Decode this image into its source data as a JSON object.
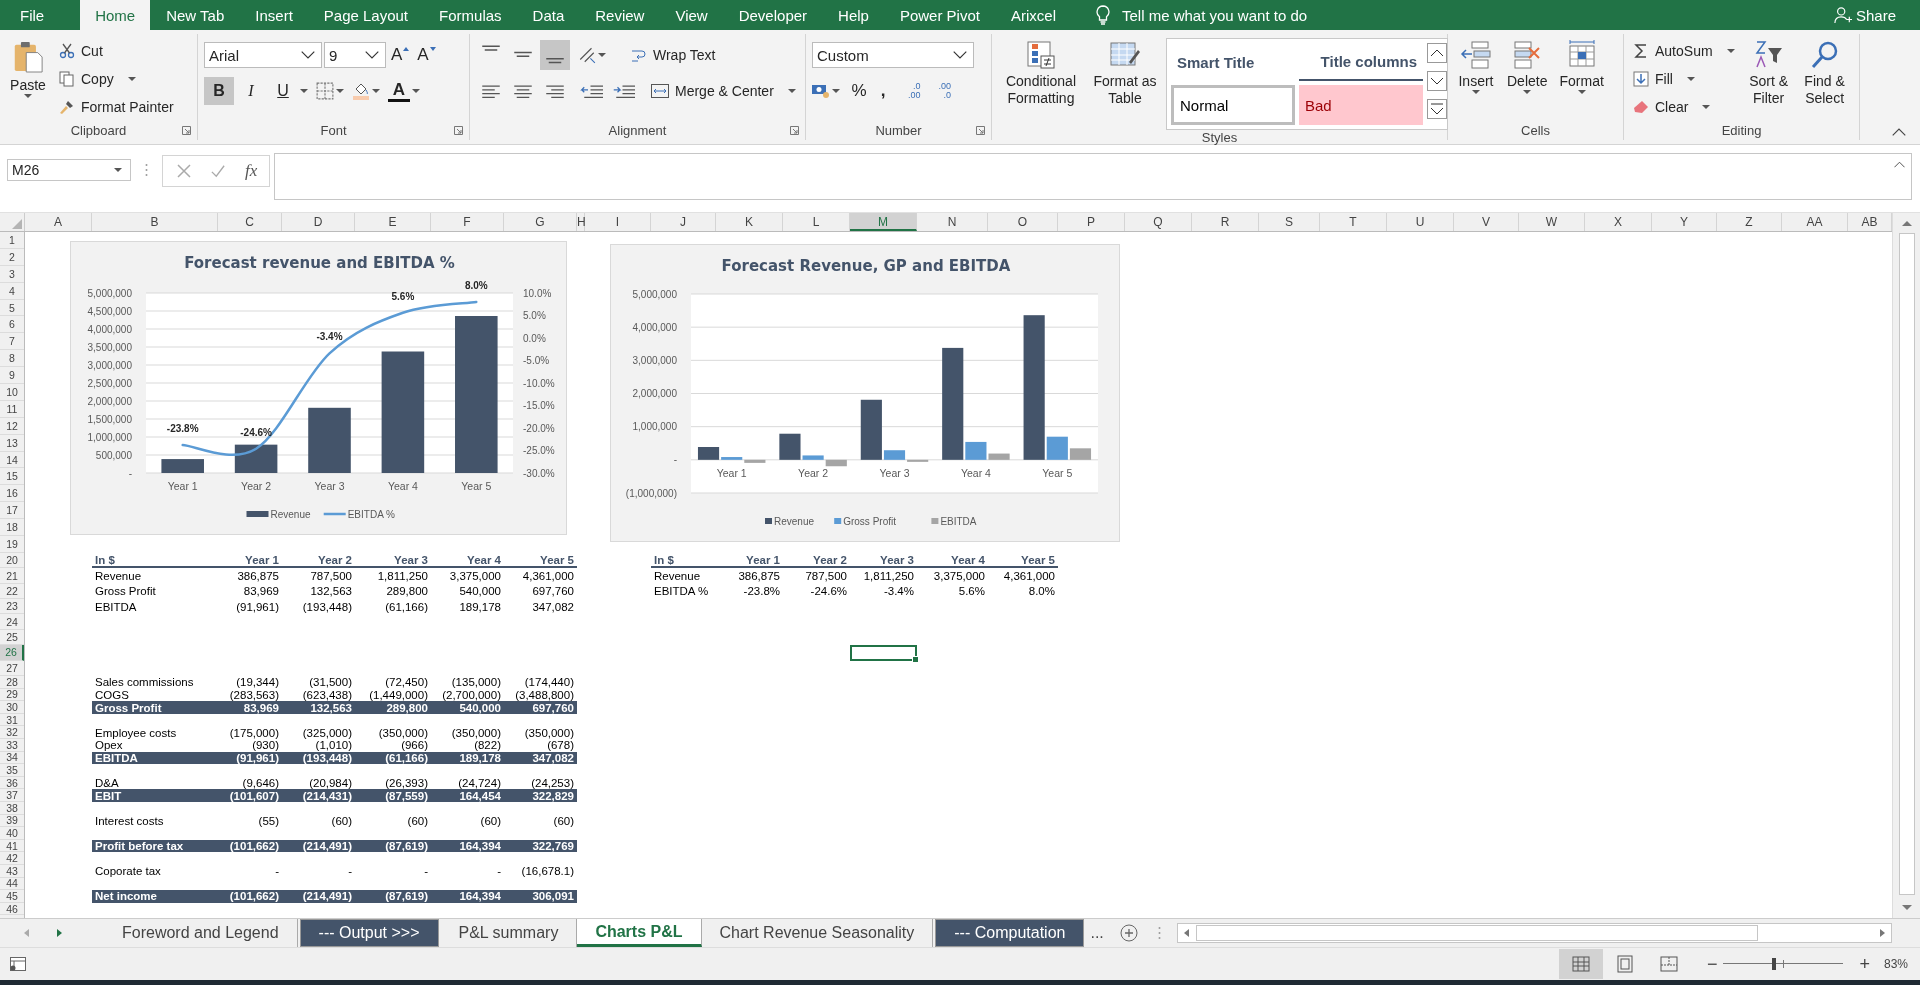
{
  "menu": {
    "tabs": [
      {
        "label": "File",
        "selected": false
      },
      {
        "label": "Home",
        "selected": true
      },
      {
        "label": "New Tab",
        "selected": false
      },
      {
        "label": "Insert",
        "selected": false
      },
      {
        "label": "Page Layout",
        "selected": false
      },
      {
        "label": "Formulas",
        "selected": false
      },
      {
        "label": "Data",
        "selected": false
      },
      {
        "label": "Review",
        "selected": false
      },
      {
        "label": "View",
        "selected": false
      },
      {
        "label": "Developer",
        "selected": false
      },
      {
        "label": "Help",
        "selected": false
      },
      {
        "label": "Power Pivot",
        "selected": false
      },
      {
        "label": "Arixcel",
        "selected": false
      }
    ],
    "tell_me": "Tell me what you want to do",
    "share": "Share"
  },
  "ribbon": {
    "clipboard": {
      "paste": "Paste",
      "cut": "Cut",
      "copy": "Copy",
      "format_painter": "Format Painter",
      "label": "Clipboard"
    },
    "font": {
      "name": "Arial",
      "size": "9",
      "grow": "A",
      "shrink": "A",
      "styles": [
        {
          "label": "B",
          "on": true
        },
        {
          "label": "I",
          "on": false
        },
        {
          "label": "U",
          "on": false
        }
      ],
      "font_color": "A",
      "label": "Font"
    },
    "alignment": {
      "vertical": [
        {
          "selected": false
        },
        {
          "selected": false
        },
        {
          "selected": true
        }
      ],
      "wrap_text": "Wrap Text",
      "merge_center": "Merge & Center",
      "label": "Alignment"
    },
    "number": {
      "format": "Custom",
      "percent": "%",
      "comma": ",",
      "increase_decimal": {
        "top": ".0",
        "bottom": ".00"
      },
      "decrease_decimal": {
        "top": ".00",
        "bottom": ".0"
      },
      "label": "Number"
    },
    "styles": {
      "conditional_formatting": "Conditional Formatting",
      "format_as_table": "Format as Table",
      "cells": [
        {
          "label": "Smart Title",
          "kind": "smart-title"
        },
        {
          "label": "Title columns",
          "kind": "title-columns"
        },
        {
          "label": "Normal",
          "kind": "normal"
        },
        {
          "label": "Bad",
          "kind": "bad"
        }
      ],
      "label": "Styles"
    },
    "cells": {
      "insert": "Insert",
      "delete": "Delete",
      "format": "Format",
      "label": "Cells"
    },
    "editing": {
      "autosum": "AutoSum",
      "fill": "Fill",
      "clear": "Clear",
      "sort_filter": "Sort & Filter",
      "find_select": "Find & Select",
      "label": "Editing"
    }
  },
  "formula_bar": {
    "name_box": "M26",
    "fx": "fx"
  },
  "sheet": {
    "columns": [
      {
        "label": "A",
        "selected": false
      },
      {
        "label": "B",
        "selected": false
      },
      {
        "label": "C",
        "selected": false
      },
      {
        "label": "D",
        "selected": false
      },
      {
        "label": "E",
        "selected": false
      },
      {
        "label": "F",
        "selected": false
      },
      {
        "label": "G",
        "selected": false
      },
      {
        "label": "H",
        "selected": false
      },
      {
        "label": "I",
        "selected": false
      },
      {
        "label": "J",
        "selected": false
      },
      {
        "label": "K",
        "selected": false
      },
      {
        "label": "L",
        "selected": false
      },
      {
        "label": "M",
        "selected": true
      },
      {
        "label": "N",
        "selected": false
      },
      {
        "label": "O",
        "selected": false
      },
      {
        "label": "P",
        "selected": false
      },
      {
        "label": "Q",
        "selected": false
      },
      {
        "label": "R",
        "selected": false
      },
      {
        "label": "S",
        "selected": false
      },
      {
        "label": "T",
        "selected": false
      },
      {
        "label": "U",
        "selected": false
      },
      {
        "label": "V",
        "selected": false
      },
      {
        "label": "W",
        "selected": false
      },
      {
        "label": "X",
        "selected": false
      },
      {
        "label": "Y",
        "selected": false
      },
      {
        "label": "Z",
        "selected": false
      },
      {
        "label": "AA",
        "selected": false
      },
      {
        "label": "AB",
        "selected": false
      }
    ],
    "rows": [
      {
        "label": "1",
        "selected": false
      },
      {
        "label": "2",
        "selected": false
      },
      {
        "label": "3",
        "selected": false
      },
      {
        "label": "4",
        "selected": false
      },
      {
        "label": "5",
        "selected": false
      },
      {
        "label": "6",
        "selected": false
      },
      {
        "label": "7",
        "selected": false
      },
      {
        "label": "8",
        "selected": false
      },
      {
        "label": "9",
        "selected": false
      },
      {
        "label": "10",
        "selected": false
      },
      {
        "label": "11",
        "selected": false
      },
      {
        "label": "12",
        "selected": false
      },
      {
        "label": "13",
        "selected": false
      },
      {
        "label": "14",
        "selected": false
      },
      {
        "label": "15",
        "selected": false
      },
      {
        "label": "16",
        "selected": false
      },
      {
        "label": "17",
        "selected": false
      },
      {
        "label": "18",
        "selected": false
      },
      {
        "label": "19",
        "selected": false
      },
      {
        "label": "20",
        "selected": false
      },
      {
        "label": "21",
        "selected": false
      },
      {
        "label": "22",
        "selected": false
      },
      {
        "label": "23",
        "selected": false
      },
      {
        "label": "24",
        "selected": false
      },
      {
        "label": "25",
        "selected": false
      },
      {
        "label": "26",
        "selected": true
      },
      {
        "label": "27",
        "selected": false
      },
      {
        "label": "28",
        "selected": false
      },
      {
        "label": "29",
        "selected": false
      },
      {
        "label": "30",
        "selected": false
      },
      {
        "label": "31",
        "selected": false
      },
      {
        "label": "32",
        "selected": false
      },
      {
        "label": "33",
        "selected": false
      },
      {
        "label": "34",
        "selected": false
      },
      {
        "label": "35",
        "selected": false
      },
      {
        "label": "36",
        "selected": false
      },
      {
        "label": "37",
        "selected": false
      },
      {
        "label": "38",
        "selected": false
      },
      {
        "label": "39",
        "selected": false
      },
      {
        "label": "40",
        "selected": false
      },
      {
        "label": "41",
        "selected": false
      },
      {
        "label": "42",
        "selected": false
      },
      {
        "label": "43",
        "selected": false
      },
      {
        "label": "44",
        "selected": false
      },
      {
        "label": "45",
        "selected": false
      },
      {
        "label": "46",
        "selected": false
      }
    ],
    "charts": [
      {
        "chart_data": {
          "type": "bar",
          "title": "Forecast revenue and EBITDA %",
          "categories": [
            "Year 1",
            "Year 2",
            "Year 3",
            "Year 4",
            "Year 5"
          ],
          "series": [
            {
              "name": "Revenue",
              "color": "#44546a",
              "type": "bar",
              "values": [
                386875,
                787500,
                1811250,
                3375000,
                4361000
              ]
            },
            {
              "name": "EBITDA %",
              "color": "#5b9bd5",
              "type": "line",
              "axis": "y2",
              "values": [
                -23.8,
                -24.6,
                -3.4,
                5.6,
                8.0
              ]
            }
          ],
          "grid": true,
          "legend": "bottom",
          "ylim": [
            0,
            5000000
          ],
          "yticks": [
            {
              "value": 0,
              "label": "-"
            },
            {
              "value": 500000,
              "label": "500,000"
            },
            {
              "value": 1000000,
              "label": "1,000,000"
            },
            {
              "value": 1500000,
              "label": "1,500,000"
            },
            {
              "value": 2000000,
              "label": "2,000,000"
            },
            {
              "value": 2500000,
              "label": "2,500,000"
            },
            {
              "value": 3000000,
              "label": "3,000,000"
            },
            {
              "value": 3500000,
              "label": "3,500,000"
            },
            {
              "value": 4000000,
              "label": "4,000,000"
            },
            {
              "value": 4500000,
              "label": "4,500,000"
            },
            {
              "value": 5000000,
              "label": "5,000,000"
            }
          ],
          "y2lim": [
            -30,
            10
          ],
          "y2ticks": [
            {
              "value": -30,
              "label": "-30.0%"
            },
            {
              "value": -25,
              "label": "-25.0%"
            },
            {
              "value": -20,
              "label": "-20.0%"
            },
            {
              "value": -15,
              "label": "-15.0%"
            },
            {
              "value": -10,
              "label": "-10.0%"
            },
            {
              "value": -5,
              "label": "-5.0%"
            },
            {
              "value": 0,
              "label": "0.0%"
            },
            {
              "value": 5,
              "label": "5.0%"
            },
            {
              "value": 10,
              "label": "10.0%"
            }
          ],
          "value_labels": [
            "-23.8%",
            "-24.6%",
            "-3.4%",
            "5.6%",
            "8.0%"
          ]
        }
      },
      {
        "chart_data": {
          "type": "bar",
          "title": "Forecast Revenue, GP and EBITDA",
          "categories": [
            "Year 1",
            "Year 2",
            "Year 3",
            "Year 4",
            "Year 5"
          ],
          "series": [
            {
              "name": "Revenue",
              "color": "#44546a",
              "type": "bar",
              "values": [
                386875,
                787500,
                1811250,
                3375000,
                4361000
              ]
            },
            {
              "name": "Gross Profit",
              "color": "#5b9bd5",
              "type": "bar",
              "values": [
                83969,
                132563,
                289800,
                540000,
                697760
              ]
            },
            {
              "name": "EBITDA",
              "color": "#a5a5a5",
              "type": "bar",
              "values": [
                -91961,
                -193448,
                -61166,
                189178,
                347082
              ]
            }
          ],
          "grid": true,
          "legend": "bottom",
          "ylim": [
            -1000000,
            5000000
          ],
          "yticks": [
            {
              "value": -1000000,
              "label": "(1,000,000)"
            },
            {
              "value": 0,
              "label": "-"
            },
            {
              "value": 1000000,
              "label": "1,000,000"
            },
            {
              "value": 2000000,
              "label": "2,000,000"
            },
            {
              "value": 3000000,
              "label": "3,000,000"
            },
            {
              "value": 4000000,
              "label": "4,000,000"
            },
            {
              "value": 5000000,
              "label": "5,000,000"
            }
          ]
        }
      }
    ],
    "summary_table": {
      "columns": [
        "In $",
        "Year 1",
        "Year 2",
        "Year 3",
        "Year 4",
        "Year 5"
      ],
      "rows": [
        [
          "Revenue",
          "386,875",
          "787,500",
          "1,811,250",
          "3,375,000",
          "4,361,000"
        ],
        [
          "Gross Profit",
          "83,969",
          "132,563",
          "289,800",
          "540,000",
          "697,760"
        ],
        [
          "EBITDA",
          "(91,961)",
          "(193,448)",
          "(61,166)",
          "189,178",
          "347,082"
        ]
      ]
    },
    "ebitda_table": {
      "columns": [
        "In $",
        "Year 1",
        "Year 2",
        "Year 3",
        "Year 4",
        "Year 5"
      ],
      "rows": [
        [
          "Revenue",
          "386,875",
          "787,500",
          "1,811,250",
          "3,375,000",
          "4,361,000"
        ],
        [
          "EBITDA %",
          "-23.8%",
          "-24.6%",
          "-3.4%",
          "5.6%",
          "8.0%"
        ]
      ]
    },
    "pnl_table": {
      "sections": [
        [
          {
            "kind": "line",
            "cells": [
              "Sales commissions",
              "(19,344)",
              "(31,500)",
              "(72,450)",
              "(135,000)",
              "(174,440)"
            ]
          },
          {
            "kind": "line",
            "cells": [
              "COGS",
              "(283,563)",
              "(623,438)",
              "(1,449,000)",
              "(2,700,000)",
              "(3,488,800)"
            ]
          },
          {
            "kind": "total",
            "cells": [
              "Gross Profit",
              "83,969",
              "132,563",
              "289,800",
              "540,000",
              "697,760"
            ]
          }
        ],
        [
          {
            "kind": "line",
            "cells": [
              "Employee costs",
              "(175,000)",
              "(325,000)",
              "(350,000)",
              "(350,000)",
              "(350,000)"
            ]
          },
          {
            "kind": "line",
            "cells": [
              "Opex",
              "(930)",
              "(1,010)",
              "(966)",
              "(822)",
              "(678)"
            ]
          },
          {
            "kind": "total",
            "cells": [
              "EBITDA",
              "(91,961)",
              "(193,448)",
              "(61,166)",
              "189,178",
              "347,082"
            ]
          }
        ],
        [
          {
            "kind": "line",
            "cells": [
              "D&A",
              "(9,646)",
              "(20,984)",
              "(26,393)",
              "(24,724)",
              "(24,253)"
            ]
          },
          {
            "kind": "total",
            "cells": [
              "EBIT",
              "(101,607)",
              "(214,431)",
              "(87,559)",
              "164,454",
              "322,829"
            ]
          }
        ],
        [
          {
            "kind": "line",
            "cells": [
              "Interest costs",
              "(55)",
              "(60)",
              "(60)",
              "(60)",
              "(60)"
            ]
          }
        ],
        [
          {
            "kind": "total",
            "cells": [
              "Profit before tax",
              "(101,662)",
              "(214,491)",
              "(87,619)",
              "164,394",
              "322,769"
            ]
          }
        ],
        [
          {
            "kind": "line",
            "cells": [
              "Coporate tax",
              "-",
              "-",
              "-",
              "-",
              "(16,678.1)"
            ]
          }
        ],
        [
          {
            "kind": "total",
            "cells": [
              "Net income",
              "(101,662)",
              "(214,491)",
              "(87,619)",
              "164,394",
              "306,091"
            ]
          }
        ]
      ]
    }
  },
  "sheet_tabs": {
    "tabs": [
      {
        "label": "Foreword and Legend",
        "selected": false
      },
      {
        "label": "--- Output >>>",
        "selected": false,
        "color": "#44546a"
      },
      {
        "label": "P&L summary",
        "selected": false
      },
      {
        "label": "Charts P&L",
        "selected": true
      },
      {
        "label": "Chart Revenue Seasonality",
        "selected": false
      },
      {
        "label": "--- Computation",
        "selected": false,
        "color": "#44546a"
      }
    ],
    "more": "..."
  },
  "status_bar": {
    "views": [
      {
        "selected": true
      },
      {
        "selected": false
      },
      {
        "selected": false
      }
    ],
    "zoom_out": "−",
    "zoom_in": "+",
    "zoom_slider": {
      "level": 0.42
    },
    "zoom": "83%"
  }
}
